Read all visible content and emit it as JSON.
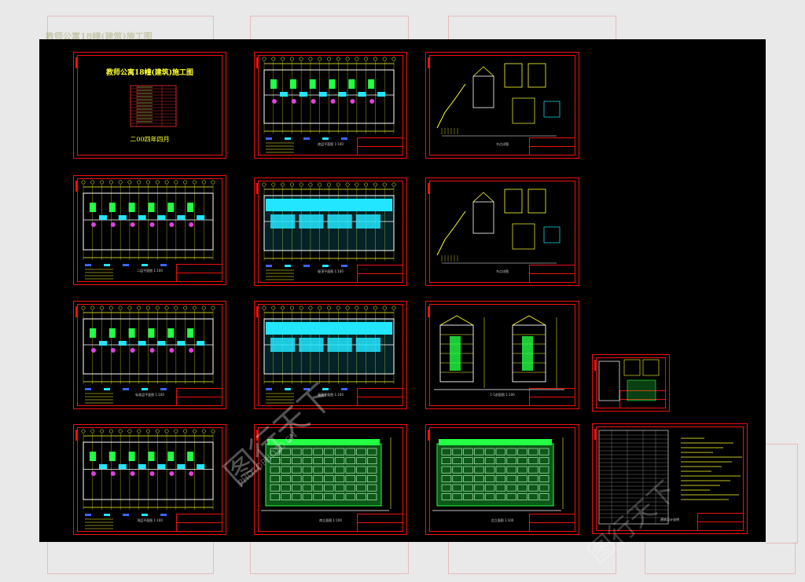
{
  "viewer": {
    "background": "#e9e9e9",
    "canvas_color": "#000000",
    "frame_color": "#e11111",
    "plan_color": "#ffff33",
    "accent_cyan": "#22e6ff",
    "accent_green": "#22ff44"
  },
  "sheets": [
    {
      "kind": "cover",
      "title": "教师公寓18幢(建筑)施工图",
      "date": "二00四年四月"
    },
    {
      "kind": "floor-plan",
      "caption": "底层平面图 1:100"
    },
    {
      "kind": "details",
      "caption": "节点详图"
    },
    {
      "kind": "floor-plan",
      "caption": "二层平面图 1:100"
    },
    {
      "kind": "floor-plan-cyan",
      "caption": "屋顶平面图 1:100"
    },
    {
      "kind": "details",
      "caption": "节点详图"
    },
    {
      "kind": "floor-plan",
      "caption": "标准层平面图 1:100"
    },
    {
      "kind": "roof-plan",
      "caption": "屋面平面图 1:100"
    },
    {
      "kind": "sections",
      "caption": "1-1剖面图 1:100"
    },
    {
      "kind": "small-detail",
      "caption": ""
    },
    {
      "kind": "floor-plan",
      "caption": "顶层平面图 1:100"
    },
    {
      "kind": "elevation",
      "caption": "南立面图 1:100"
    },
    {
      "kind": "elevation",
      "caption": "北立面图 1:100"
    },
    {
      "kind": "notes",
      "caption": "建筑设计说明"
    }
  ],
  "background_title": "教师公寓18幢(建筑)施工图",
  "watermark": {
    "cn": "图行天下",
    "en": "PHOTOPHOTO.CN"
  }
}
